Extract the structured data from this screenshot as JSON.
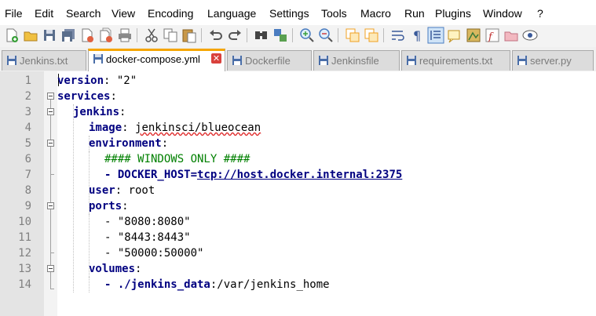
{
  "menu": {
    "items": [
      "File",
      "Edit",
      "Search",
      "View",
      "Encoding",
      "Language",
      "Settings",
      "Tools",
      "Macro",
      "Run",
      "Plugins",
      "Window",
      "?"
    ]
  },
  "toolbar": {
    "icons": [
      "new-file-icon",
      "open-file-icon",
      "save-icon",
      "save-all-icon",
      "close-icon",
      "close-all-icon",
      "print-icon",
      "cut-icon",
      "copy-icon",
      "paste-icon",
      "undo-icon",
      "redo-icon",
      "find-icon",
      "replace-icon",
      "zoom-in-icon",
      "zoom-out-icon",
      "sync-vertical-icon",
      "sync-horizontal-icon",
      "word-wrap-icon",
      "show-all-chars-icon",
      "indent-guide-icon",
      "user-language-icon",
      "doc-map-icon",
      "function-list-icon",
      "folder-workspace-icon",
      "monitoring-icon"
    ]
  },
  "tabs": [
    {
      "label": "Jenkins.txt",
      "active": false
    },
    {
      "label": "docker-compose.yml",
      "active": true
    },
    {
      "label": "Dockerfile",
      "active": false
    },
    {
      "label": "Jenkinsfile",
      "active": false
    },
    {
      "label": "requirements.txt",
      "active": false
    },
    {
      "label": "server.py",
      "active": false
    }
  ],
  "editor": {
    "line_numbers": [
      "1",
      "2",
      "3",
      "4",
      "5",
      "6",
      "7",
      "8",
      "9",
      "10",
      "11",
      "12",
      "13",
      "14"
    ],
    "lines": {
      "l1_key": "version",
      "l1_val": ": \"2\"",
      "l2_key": "services",
      "l2_val": ":",
      "l3_key": "jenkins",
      "l3_val": ":",
      "l4_key": "image",
      "l4_colon": ": ",
      "l4_val": "jenkinsci/blueocean",
      "l5_key": "environment",
      "l5_val": ":",
      "l6_comment": "#### WINDOWS ONLY ####",
      "l7_dash": "- ",
      "l7_key": "DOCKER_HOST=",
      "l7_val": "tcp://host.docker.internal:2375",
      "l8_key": "user",
      "l8_val": ": root",
      "l9_key": "ports",
      "l9_val": ":",
      "l10_val": "- \"8080:8080\"",
      "l11_val": "- \"8443:8443\"",
      "l12_val": "- \"50000:50000\"",
      "l13_key": "volumes",
      "l13_val": ":",
      "l14_dash": "- ",
      "l14_key": "./jenkins_data",
      "l14_val": ":/var/jenkins_home"
    }
  },
  "colors": {
    "keyword": "#000080",
    "comment": "#008000",
    "active_tab_accent": "#f5a500",
    "tab_close": "#d9413c"
  }
}
